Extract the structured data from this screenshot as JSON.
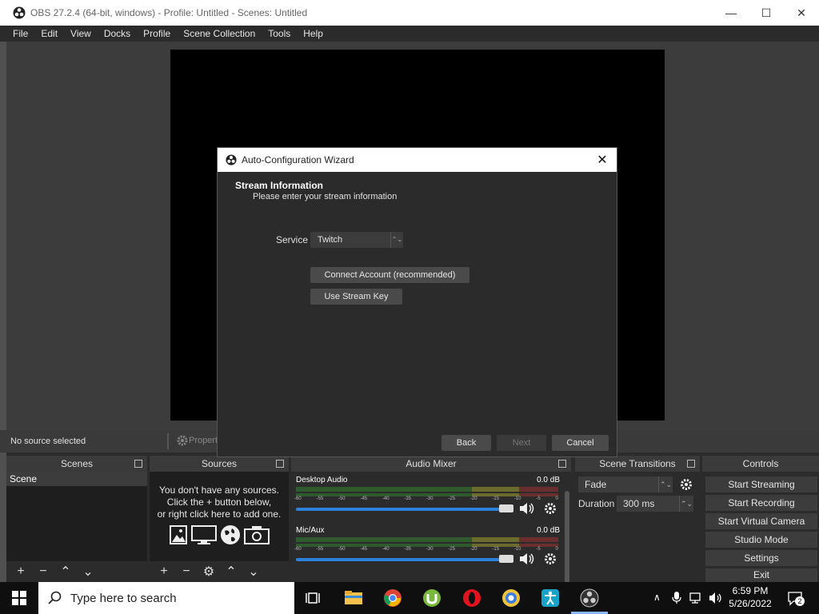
{
  "window": {
    "title": "OBS 27.2.4 (64-bit, windows) - Profile: Untitled - Scenes: Untitled",
    "controls": {
      "minimize": "—",
      "maximize": "☐",
      "close": "✕"
    }
  },
  "menu": [
    "File",
    "Edit",
    "View",
    "Docks",
    "Profile",
    "Scene Collection",
    "Tools",
    "Help"
  ],
  "source_toolbar": {
    "status": "No source selected",
    "properties_label": "Propert"
  },
  "docks": {
    "scenes": {
      "title": "Scenes",
      "items": [
        "Scene"
      ]
    },
    "sources": {
      "title": "Sources",
      "empty_lines": [
        "You don't have any sources.",
        "Click the + button below,",
        "or right click here to add one."
      ]
    },
    "audio_mixer": {
      "title": "Audio Mixer",
      "channels": [
        {
          "name": "Desktop Audio",
          "level": "0.0 dB",
          "volume": 1.0
        },
        {
          "name": "Mic/Aux",
          "level": "0.0 dB",
          "volume": 1.0
        }
      ],
      "ticks": [
        "-60",
        "-55",
        "-50",
        "-45",
        "-40",
        "-35",
        "-30",
        "-25",
        "-20",
        "-15",
        "-10",
        "-5",
        "0"
      ]
    },
    "scene_transitions": {
      "title": "Scene Transitions",
      "transition": "Fade",
      "duration_label": "Duration",
      "duration_value": "300 ms"
    },
    "controls": {
      "title": "Controls",
      "buttons": [
        "Start Streaming",
        "Start Recording",
        "Start Virtual Camera",
        "Studio Mode",
        "Settings",
        "Exit"
      ]
    }
  },
  "dialog": {
    "title": "Auto-Configuration Wizard",
    "heading": "Stream Information",
    "subheading": "Please enter your stream information",
    "service_label": "Service",
    "service_value": "Twitch",
    "connect_button": "Connect Account (recommended)",
    "stream_key_button": "Use Stream Key",
    "back_button": "Back",
    "next_button": "Next",
    "cancel_button": "Cancel"
  },
  "taskbar": {
    "search_placeholder": "Type here to search",
    "time": "6:59 PM",
    "date": "5/26/2022",
    "notification_count": "2"
  },
  "colors": {
    "accent": "#2a82da",
    "dock_bg": "#2b2b2b",
    "panel_bg": "#1e1e1e"
  }
}
